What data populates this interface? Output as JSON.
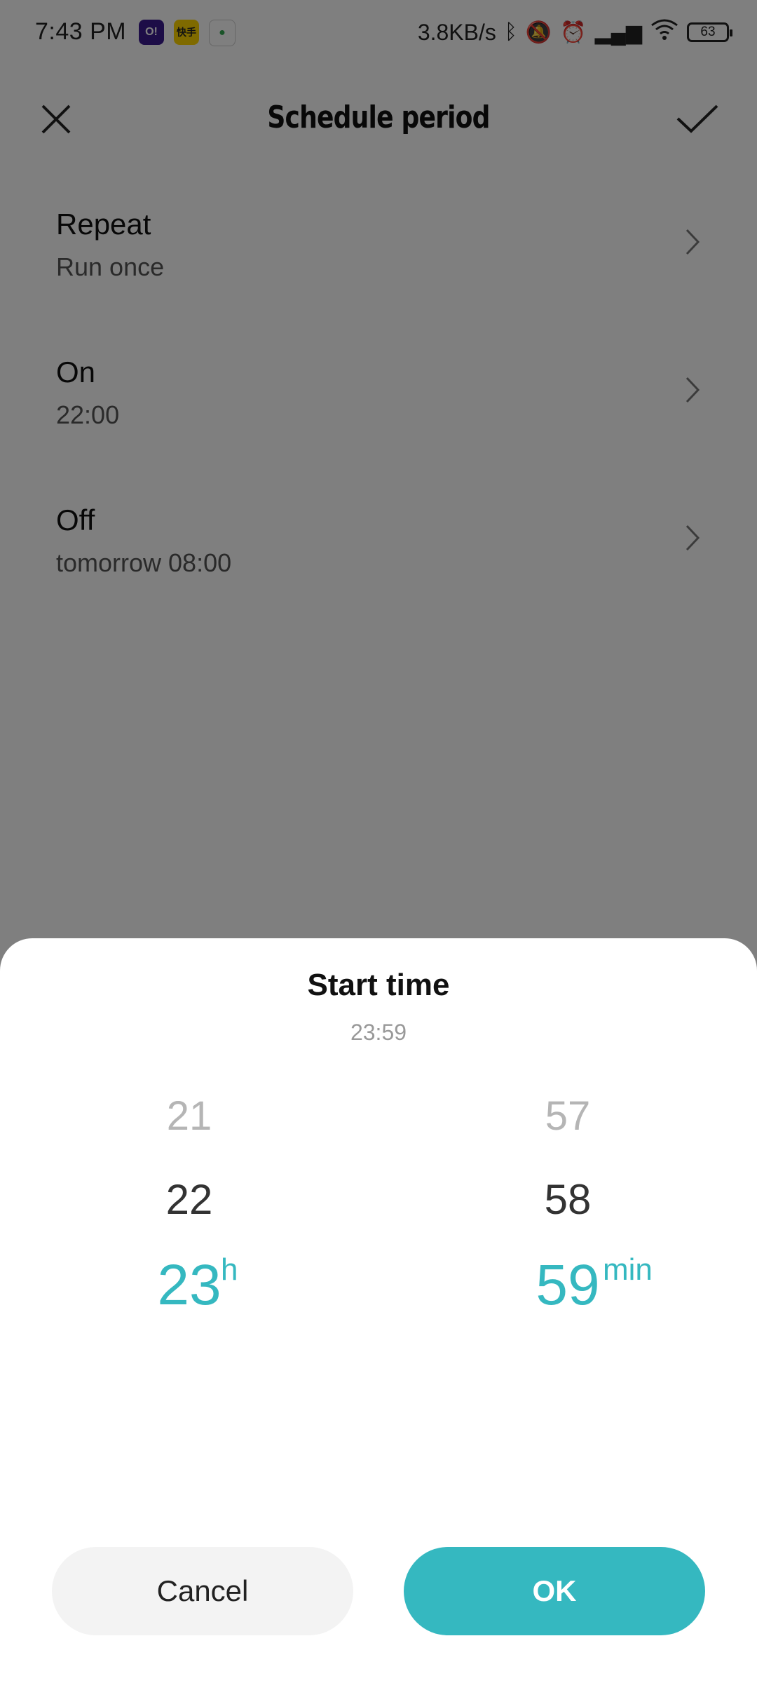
{
  "status_bar": {
    "time": "7:43 PM",
    "notification_apps": [
      "O!",
      "快手",
      "●"
    ],
    "network_speed": "3.8KB/s",
    "battery": "63",
    "icons": [
      "bluetooth-icon",
      "mute-icon",
      "alarm-icon",
      "signal-icon",
      "wifi-icon",
      "battery-icon"
    ]
  },
  "header": {
    "title": "Schedule period"
  },
  "settings": [
    {
      "label": "Repeat",
      "value": "Run once"
    },
    {
      "label": "On",
      "value": "22:00"
    },
    {
      "label": "Off",
      "value": "tomorrow 08:00"
    }
  ],
  "sheet": {
    "title": "Start time",
    "subtitle": "23:59",
    "hours": {
      "far": "21",
      "near": "22",
      "selected": "23",
      "unit": "h"
    },
    "minutes": {
      "far": "57",
      "near": "58",
      "selected": "59",
      "unit": "min"
    },
    "cancel_label": "Cancel",
    "ok_label": "OK"
  },
  "colors": {
    "accent": "#35b8c0",
    "overlay": "#000000",
    "cancel_bg": "#f3f3f3"
  }
}
